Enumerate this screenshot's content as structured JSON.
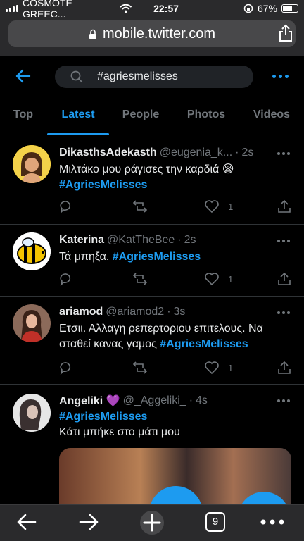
{
  "status_bar": {
    "carrier": "COSMOTE GREEC...",
    "time": "22:57",
    "battery": "67%",
    "battery_level": 0.67
  },
  "browser": {
    "url": "mobile.twitter.com"
  },
  "search": {
    "query": "#agriesmelisses"
  },
  "tabs": [
    {
      "label": "Top",
      "active": false
    },
    {
      "label": "Latest",
      "active": true
    },
    {
      "label": "People",
      "active": false
    },
    {
      "label": "Photos",
      "active": false
    },
    {
      "label": "Videos",
      "active": false
    }
  ],
  "tweets": [
    {
      "name": "DikasthsAdekasth",
      "handle": "@eugenia_k...",
      "time": "2s",
      "text": "Μιλτάκο μου ράγισες την καρδιά 😪",
      "hashtag": "#AgriesMelisses",
      "likes": "1"
    },
    {
      "name": "Katerina",
      "handle": "@KatTheBee",
      "time": "2s",
      "text": "Τά μπηξα.",
      "hashtag": "#AgriesMelisses",
      "likes": "1"
    },
    {
      "name": "ariamod",
      "handle": "@ariamod2",
      "time": "3s",
      "text": "Ετσιι. Αλλαγη ρεπερτοριου επιτελους. Να σταθεί κανας γαμος",
      "hashtag": "#AgriesMelisses",
      "likes": "1"
    },
    {
      "name": "Angeliki 💜",
      "handle": "@_Aggeliki_",
      "time": "4s",
      "hashtag": "#AgriesMelisses",
      "text": "Κάτι μπήκε στο μάτι μου"
    }
  ],
  "bottom_bar": {
    "tab_count": "9"
  },
  "colors": {
    "accent": "#1d9bf0",
    "background": "#000000",
    "muted": "#71767b"
  }
}
